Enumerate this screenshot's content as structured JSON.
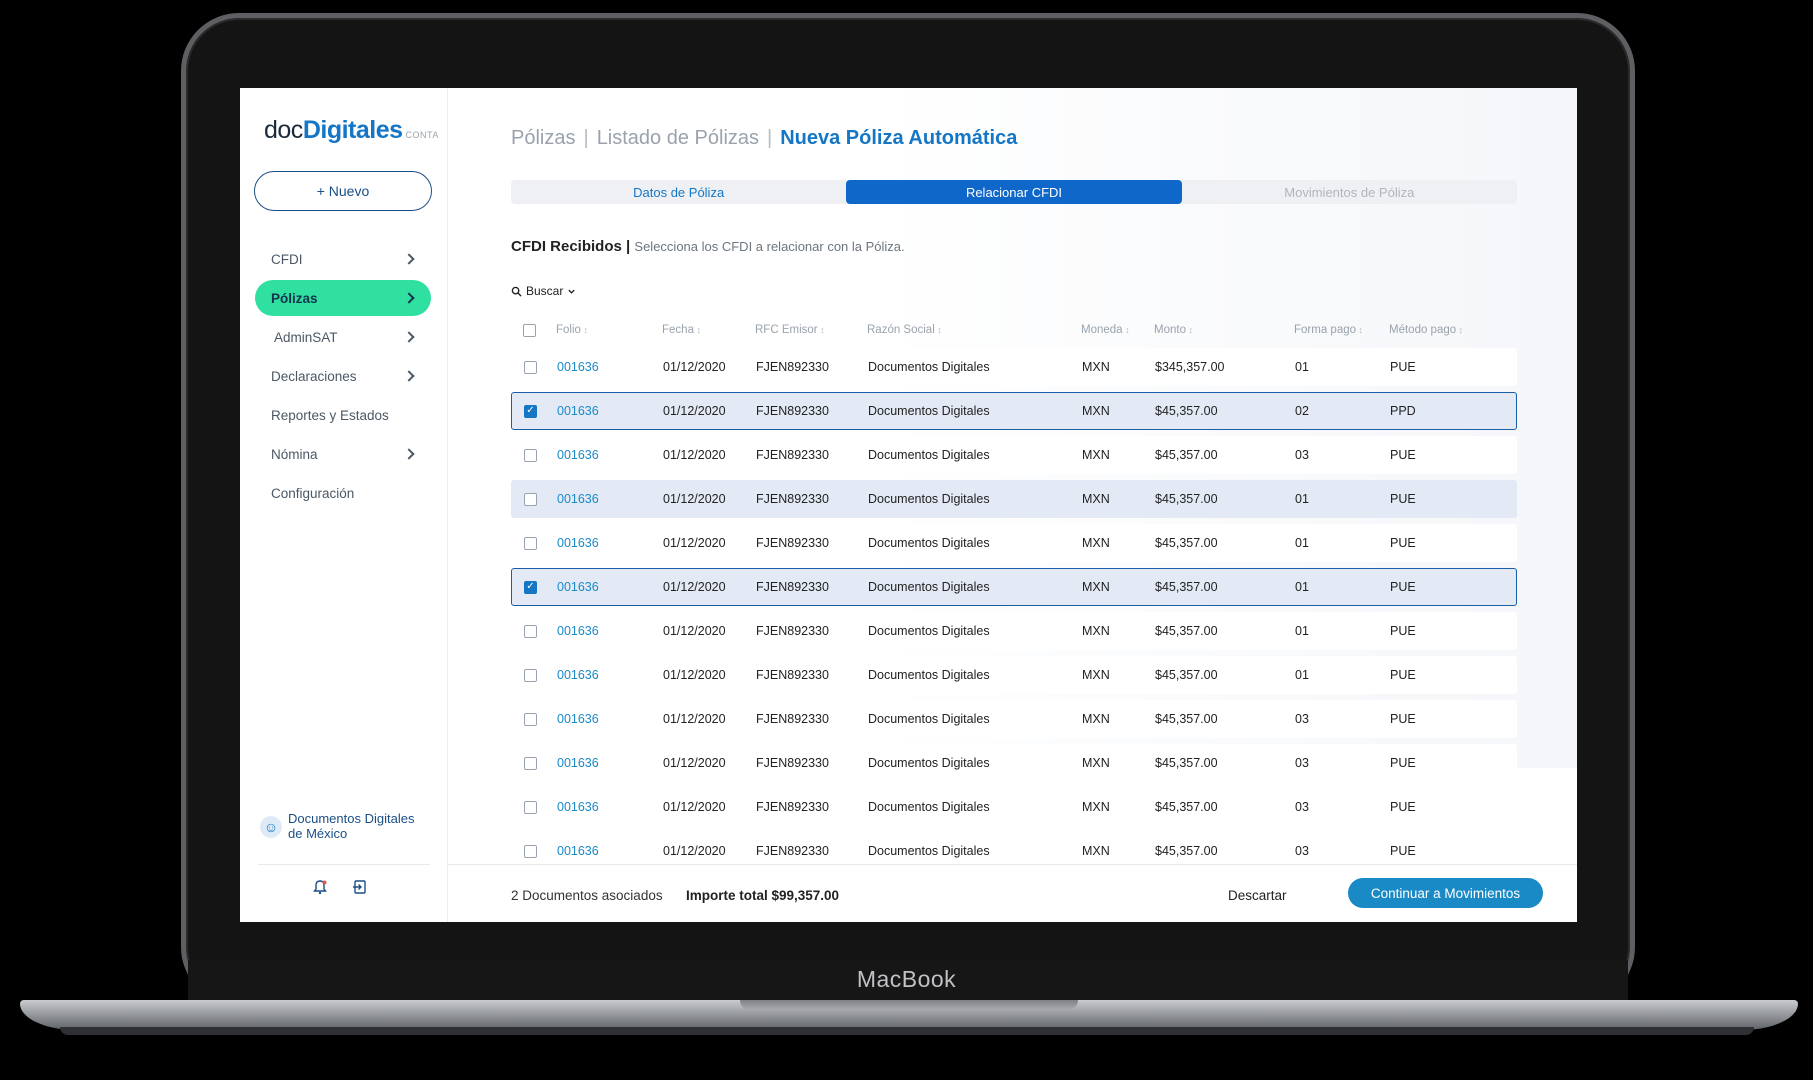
{
  "device": {
    "label": "MacBook"
  },
  "sidebar": {
    "logo": {
      "doc": "doc",
      "dig": "Digitales",
      "conta": "CONTA"
    },
    "new_button": "+ Nuevo",
    "items": [
      {
        "label": "CFDI",
        "chevron": true,
        "active": false
      },
      {
        "label": "Pólizas",
        "chevron": true,
        "active": true
      },
      {
        "label": "AdminSAT",
        "chevron": true,
        "active": false
      },
      {
        "label": "Declaraciones",
        "chevron": true,
        "active": false
      },
      {
        "label": "Reportes y Estados",
        "chevron": false,
        "active": false
      },
      {
        "label": "Nómina",
        "chevron": true,
        "active": false
      },
      {
        "label": "Configuración",
        "chevron": false,
        "active": false
      }
    ],
    "org_line1": "Documentos Digitales",
    "org_line2": "de México",
    "org_icon": "smiley-icon",
    "bottom_icons": [
      "bell-icon",
      "logout-icon"
    ]
  },
  "breadcrumb": {
    "items": [
      "Pólizas",
      "Listado de Pólizas"
    ],
    "current": "Nueva Póliza Automática"
  },
  "steps": [
    {
      "label": "Datos de Póliza",
      "state": "done"
    },
    {
      "label": "Relacionar CFDI",
      "state": "active"
    },
    {
      "label": "Movimientos de Póliza",
      "state": "pending"
    }
  ],
  "section": {
    "title": "CFDI Recibidos",
    "separator": "|",
    "subtitle": "Selecciona los CFDI a relacionar con la Póliza."
  },
  "search": {
    "label": "Buscar"
  },
  "table": {
    "headers": {
      "folio": "Folio",
      "fecha": "Fecha",
      "rfc": "RFC Emisor",
      "razon": "Razón Social",
      "moneda": "Moneda",
      "monto": "Monto",
      "forma": "Forma pago",
      "metodo": "Método pago"
    },
    "rows": [
      {
        "checked": false,
        "highlight": false,
        "folio": "001636",
        "fecha": "01/12/2020",
        "rfc": "FJEN892330",
        "razon": "Documentos Digitales",
        "moneda": "MXN",
        "monto": "$345,357.00",
        "forma": "01",
        "metodo": "PUE"
      },
      {
        "checked": true,
        "highlight": false,
        "folio": "001636",
        "fecha": "01/12/2020",
        "rfc": "FJEN892330",
        "razon": "Documentos Digitales",
        "moneda": "MXN",
        "monto": "$45,357.00",
        "forma": "02",
        "metodo": "PPD"
      },
      {
        "checked": false,
        "highlight": false,
        "folio": "001636",
        "fecha": "01/12/2020",
        "rfc": "FJEN892330",
        "razon": "Documentos Digitales",
        "moneda": "MXN",
        "monto": "$45,357.00",
        "forma": "03",
        "metodo": "PUE"
      },
      {
        "checked": false,
        "highlight": true,
        "folio": "001636",
        "fecha": "01/12/2020",
        "rfc": "FJEN892330",
        "razon": "Documentos Digitales",
        "moneda": "MXN",
        "monto": "$45,357.00",
        "forma": "01",
        "metodo": "PUE"
      },
      {
        "checked": false,
        "highlight": false,
        "folio": "001636",
        "fecha": "01/12/2020",
        "rfc": "FJEN892330",
        "razon": "Documentos Digitales",
        "moneda": "MXN",
        "monto": "$45,357.00",
        "forma": "01",
        "metodo": "PUE"
      },
      {
        "checked": true,
        "highlight": false,
        "folio": "001636",
        "fecha": "01/12/2020",
        "rfc": "FJEN892330",
        "razon": "Documentos Digitales",
        "moneda": "MXN",
        "monto": "$45,357.00",
        "forma": "01",
        "metodo": "PUE"
      },
      {
        "checked": false,
        "highlight": false,
        "folio": "001636",
        "fecha": "01/12/2020",
        "rfc": "FJEN892330",
        "razon": "Documentos Digitales",
        "moneda": "MXN",
        "monto": "$45,357.00",
        "forma": "01",
        "metodo": "PUE"
      },
      {
        "checked": false,
        "highlight": false,
        "folio": "001636",
        "fecha": "01/12/2020",
        "rfc": "FJEN892330",
        "razon": "Documentos Digitales",
        "moneda": "MXN",
        "monto": "$45,357.00",
        "forma": "01",
        "metodo": "PUE"
      },
      {
        "checked": false,
        "highlight": false,
        "folio": "001636",
        "fecha": "01/12/2020",
        "rfc": "FJEN892330",
        "razon": "Documentos Digitales",
        "moneda": "MXN",
        "monto": "$45,357.00",
        "forma": "03",
        "metodo": "PUE"
      },
      {
        "checked": false,
        "highlight": false,
        "folio": "001636",
        "fecha": "01/12/2020",
        "rfc": "FJEN892330",
        "razon": "Documentos Digitales",
        "moneda": "MXN",
        "monto": "$45,357.00",
        "forma": "03",
        "metodo": "PUE"
      },
      {
        "checked": false,
        "highlight": false,
        "folio": "001636",
        "fecha": "01/12/2020",
        "rfc": "FJEN892330",
        "razon": "Documentos Digitales",
        "moneda": "MXN",
        "monto": "$45,357.00",
        "forma": "03",
        "metodo": "PUE"
      },
      {
        "checked": false,
        "highlight": false,
        "folio": "001636",
        "fecha": "01/12/2020",
        "rfc": "FJEN892330",
        "razon": "Documentos Digitales",
        "moneda": "MXN",
        "monto": "$45,357.00",
        "forma": "03",
        "metodo": "PUE"
      }
    ]
  },
  "footer": {
    "count": "2 Documentos asociados",
    "total": "Importe total $99,357.00",
    "discard": "Descartar",
    "continue": "Continuar a Movimientos"
  },
  "colors": {
    "accent": "#1576c6",
    "active_nav": "#2fe0a0",
    "primary_button": "#1a8ac7",
    "step_active": "#0e67c9"
  }
}
